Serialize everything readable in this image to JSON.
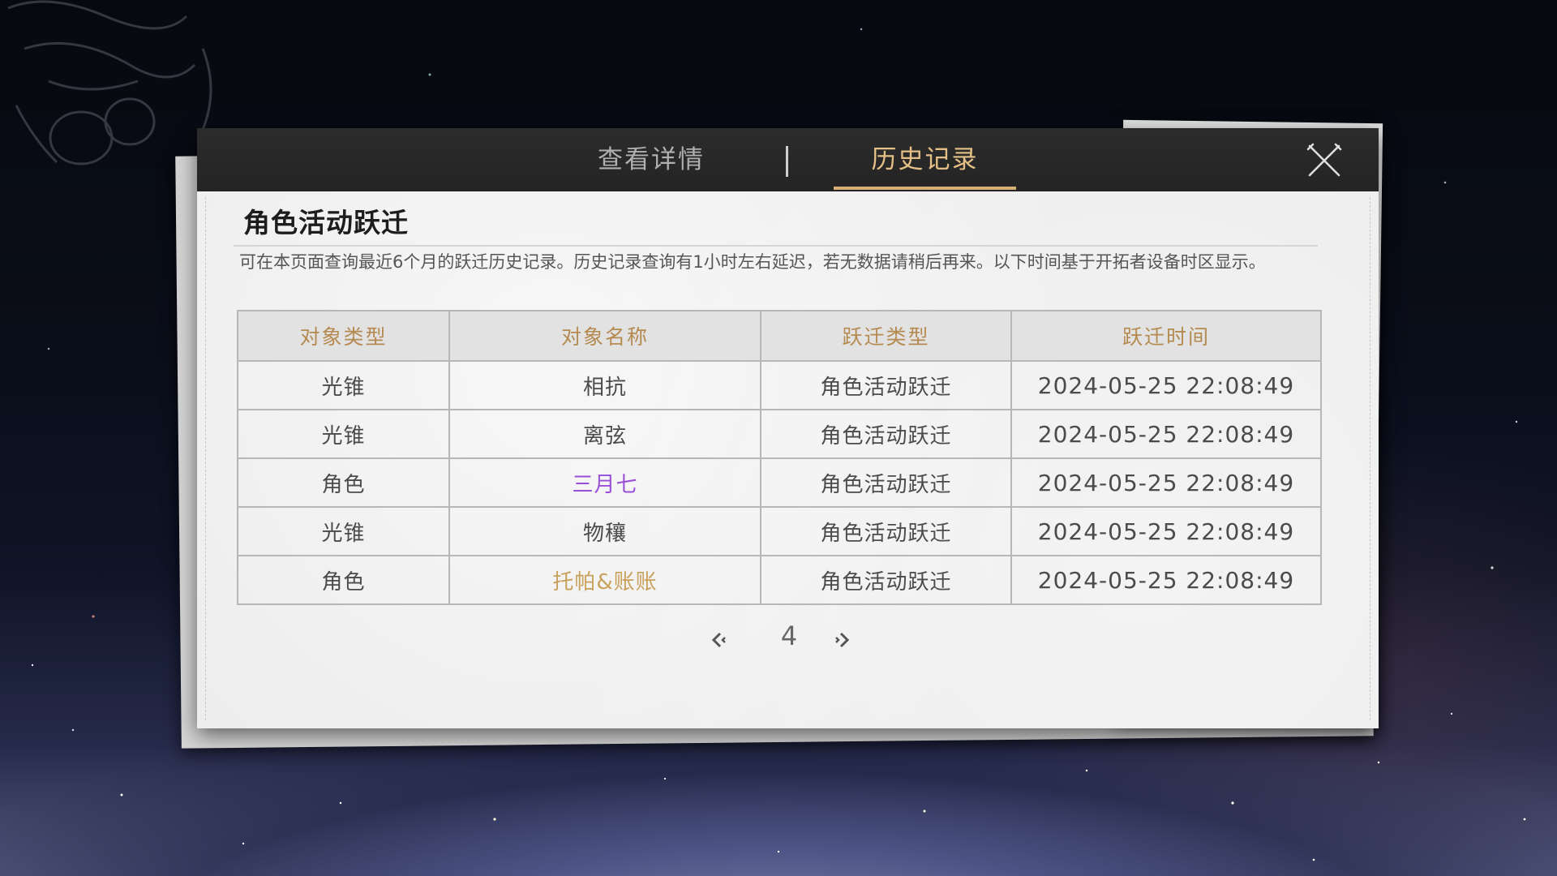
{
  "tabs": {
    "details_label": "查看详情",
    "history_label": "历史记录",
    "active": "history"
  },
  "icons": {
    "close": "close-icon",
    "prev": "chevron-left-icon",
    "next": "chevron-right-icon"
  },
  "section": {
    "title": "角色活动跃迁",
    "description": "可在本页面查询最近6个月的跃迁历史记录。历史记录查询有1小时左右延迟，若无数据请稍后再来。以下时间基于开拓者设备时区显示。"
  },
  "table": {
    "headers": [
      "对象类型",
      "对象名称",
      "跃迁类型",
      "跃迁时间"
    ],
    "rows": [
      {
        "type": "光锥",
        "name": "相抗",
        "warp_type": "角色活动跃迁",
        "time": "2024-05-25 22:08:49",
        "rarity": "normal"
      },
      {
        "type": "光锥",
        "name": "离弦",
        "warp_type": "角色活动跃迁",
        "time": "2024-05-25 22:08:49",
        "rarity": "normal"
      },
      {
        "type": "角色",
        "name": "三月七",
        "warp_type": "角色活动跃迁",
        "time": "2024-05-25 22:08:49",
        "rarity": "4-star"
      },
      {
        "type": "光锥",
        "name": "物穰",
        "warp_type": "角色活动跃迁",
        "time": "2024-05-25 22:08:49",
        "rarity": "normal"
      },
      {
        "type": "角色",
        "name": "托帕&账账",
        "warp_type": "角色活动跃迁",
        "time": "2024-05-25 22:08:49",
        "rarity": "5-star"
      }
    ]
  },
  "pagination": {
    "current_page": "4"
  },
  "colors": {
    "accent_gold": "#d7b072",
    "four_star": "#9a4fd8",
    "five_star": "#c9a05a",
    "header_text": "#b58a50"
  }
}
